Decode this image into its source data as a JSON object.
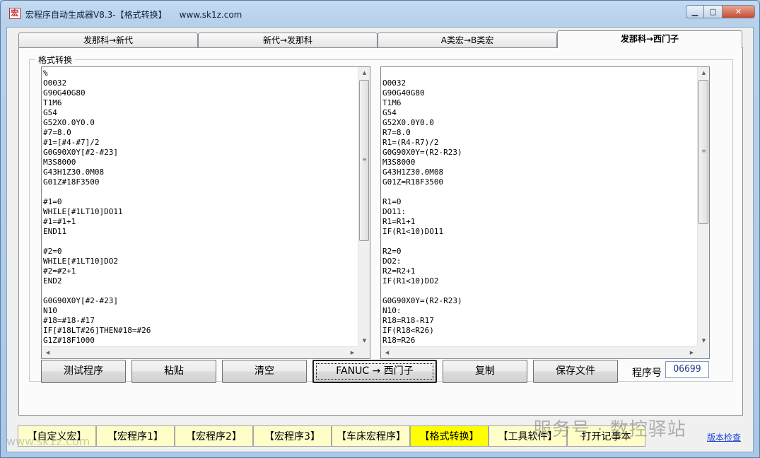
{
  "window": {
    "title": "宏程序自动生成器V8.3-【格式转换】",
    "website": "www.sk1z.com",
    "app_icon": "宏",
    "minimize_glyph": "▁",
    "maximize_glyph": "▢",
    "close_glyph": "✕"
  },
  "tabs": [
    {
      "label": "发那科→新代",
      "active": false
    },
    {
      "label": "新代→发那科",
      "active": false
    },
    {
      "label": "A类宏→B类宏",
      "active": false
    },
    {
      "label": "发那科→西门子",
      "active": true
    }
  ],
  "group_label": "格式转换",
  "source_code": [
    "%",
    "O0032",
    "G90G40G80",
    "T1M6",
    "G54",
    "G52X0.0Y0.0",
    "#7=8.0",
    "#1=[#4-#7]/2",
    "G0G90X0Y[#2-#23]",
    "M3S8000",
    "G43H1Z30.0M08",
    "G01Z#18F3500",
    "",
    "#1=0",
    "WHILE[#1LT10]DO11",
    "#1=#1+1",
    "END11",
    "",
    "#2=0",
    "WHILE[#1LT10]DO2",
    "#2=#2+1",
    "END2",
    "",
    "G0G90X0Y[#2-#23]",
    "N10",
    "#18=#18-#17",
    "IF[#18LT#26]THEN#18=#26",
    "G1Z#18F1000"
  ],
  "converted_code": [
    "",
    "O0032",
    "G90G40G80",
    "T1M6",
    "G54",
    "G52X0.0Y0.0",
    "R7=8.0",
    "R1=(R4-R7)/2",
    "G0G90X0Y=(R2-R23)",
    "M3S8000",
    "G43H1Z30.0M08",
    "G01Z=R18F3500",
    "",
    "R1=0",
    "DO11:",
    "R1=R1+1",
    "IF(R1<10)DO11",
    "",
    "R2=0",
    "DO2:",
    "R2=R2+1",
    "IF(R1<10)DO2",
    "",
    "G0G90X0Y=(R2-R23)",
    "N10:",
    "R18=R18-R17",
    "IF(R18<R26)",
    "R18=R26"
  ],
  "scroll_glyphs": {
    "up": "▲",
    "down": "▼",
    "left": "◀",
    "right": "▶",
    "grip": "≡"
  },
  "buttons": {
    "test": "测试程序",
    "paste": "粘贴",
    "clear": "清空",
    "convert": "FANUC → 西门子",
    "copy": "复制",
    "save": "保存文件"
  },
  "program_number": {
    "label": "程序号",
    "value": "O6699"
  },
  "bottom_tabs": [
    {
      "label": "【自定义宏】",
      "active": false
    },
    {
      "label": "【宏程序1】",
      "active": false
    },
    {
      "label": "【宏程序2】",
      "active": false
    },
    {
      "label": "【宏程序3】",
      "active": false
    },
    {
      "label": "【车床宏程序】",
      "active": false
    },
    {
      "label": "【格式转换】",
      "active": true
    },
    {
      "label": "【工具软件】",
      "active": false
    },
    {
      "label": "打开记事本",
      "active": false
    }
  ],
  "watermark_text": "服务号 · 数控驿站",
  "site_watermark": "www.sk1z.com",
  "version_check": "版本检查",
  "colors": {
    "active_bottom_tab": "#ffff00",
    "bottom_tab": "#fffec8",
    "link": "#1a44d6"
  }
}
